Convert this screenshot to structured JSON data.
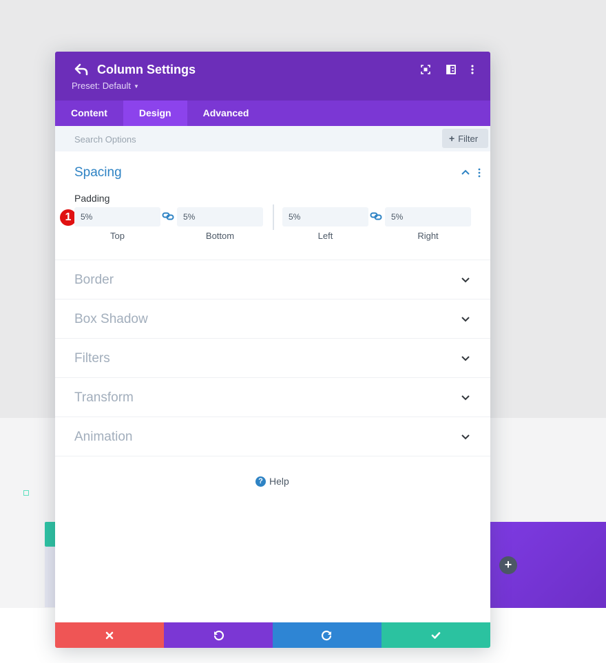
{
  "modal": {
    "title": "Column Settings",
    "preset": "Preset: Default",
    "tabs": [
      {
        "label": "Content",
        "active": false
      },
      {
        "label": "Design",
        "active": true
      },
      {
        "label": "Advanced",
        "active": false
      }
    ],
    "search": {
      "placeholder": "Search Options",
      "filter_label": "Filter"
    },
    "spacing": {
      "title": "Spacing",
      "padding_label": "Padding",
      "badge": "1",
      "fields": [
        {
          "caption": "Top",
          "value": "5%"
        },
        {
          "caption": "Bottom",
          "value": "5%"
        },
        {
          "caption": "Left",
          "value": "5%"
        },
        {
          "caption": "Right",
          "value": "5%"
        }
      ]
    },
    "sections": [
      {
        "title": "Border"
      },
      {
        "title": "Box Shadow"
      },
      {
        "title": "Filters"
      },
      {
        "title": "Transform"
      },
      {
        "title": "Animation"
      }
    ],
    "help_label": "Help"
  },
  "colors": {
    "header": "#6c2eb9",
    "tabs": "#7b37d4",
    "active_tab": "#8c43ec",
    "cancel": "#ef5555",
    "undo": "#7b37d4",
    "redo": "#2e85d4",
    "save": "#2bc2a0",
    "open_section_title": "#2e83c4",
    "badge": "#e01111"
  },
  "icons": {
    "back": "back-arrow-icon",
    "focus": "focus-icon",
    "split": "split-view-icon",
    "more": "more-vertical-icon",
    "link": "link-icon",
    "help": "help-icon",
    "cancel": "close-icon",
    "undo": "undo-icon",
    "redo": "redo-icon",
    "save": "check-icon",
    "add_row": "plus-icon"
  }
}
